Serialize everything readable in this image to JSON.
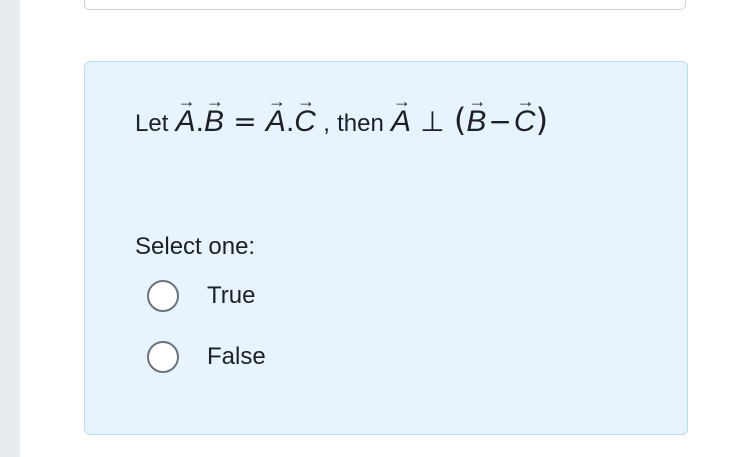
{
  "question": {
    "prefix": "Let",
    "vectors": {
      "a": "A",
      "b": "B",
      "c": "C",
      "arrow": "⃗"
    },
    "symbols": {
      "dot": ".",
      "equals": "=",
      "comma": ",",
      "perp": "⊥",
      "minus": "−",
      "lparen": "(",
      "rparen": ")"
    },
    "then": "then"
  },
  "answer": {
    "prompt": "Select one:",
    "options": [
      {
        "label": "True",
        "selected": false
      },
      {
        "label": "False",
        "selected": false
      }
    ]
  }
}
